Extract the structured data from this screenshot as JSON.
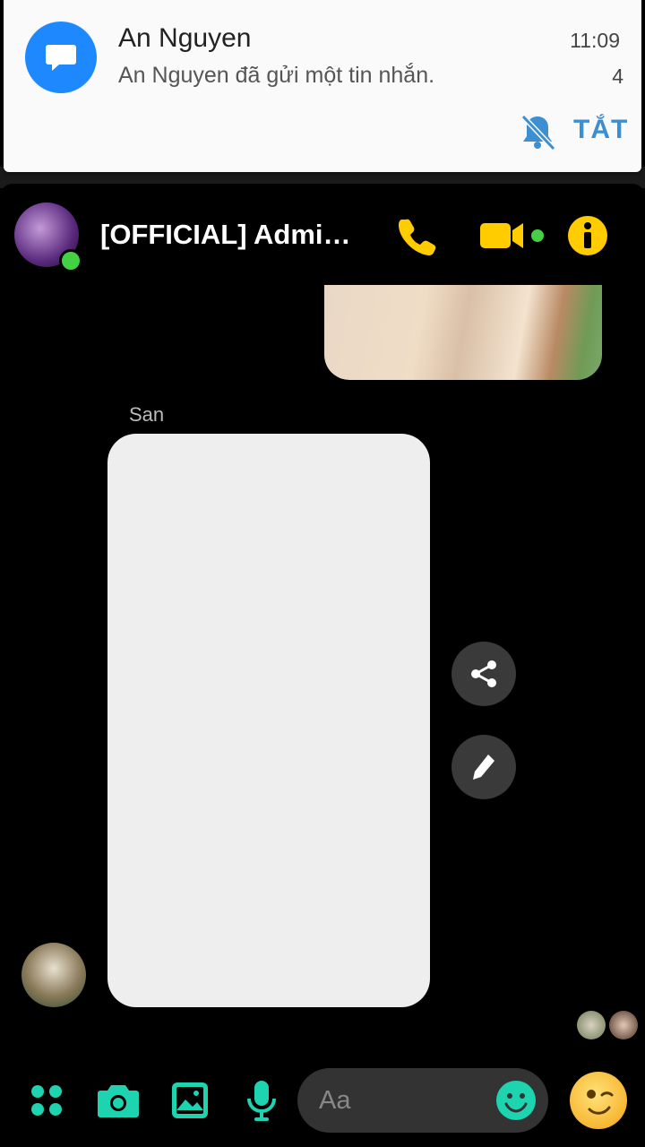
{
  "notification": {
    "sender": "An Nguyen",
    "message": "An Nguyen đã gửi một tin nhắn.",
    "time": "11:09",
    "count": "4",
    "mute_label": "TẮT",
    "accent": "#1e88ff",
    "action_color": "#3e8fd1"
  },
  "header": {
    "title": "[OFFICIAL] Admin…",
    "online": true,
    "icon_color": "#ffcc00",
    "icons": [
      "phone-icon",
      "video-call-icon",
      "info-icon"
    ]
  },
  "messages": {
    "sender_name": "San"
  },
  "actions": [
    "share-icon",
    "edit-icon"
  ],
  "composer": {
    "placeholder": "Aa",
    "tool_color": "#1dd3b0",
    "tools": [
      "more-apps-icon",
      "camera-icon",
      "gallery-icon",
      "mic-icon"
    ],
    "emoji_icon": "smile-icon",
    "sticker": "wink-emoji"
  }
}
